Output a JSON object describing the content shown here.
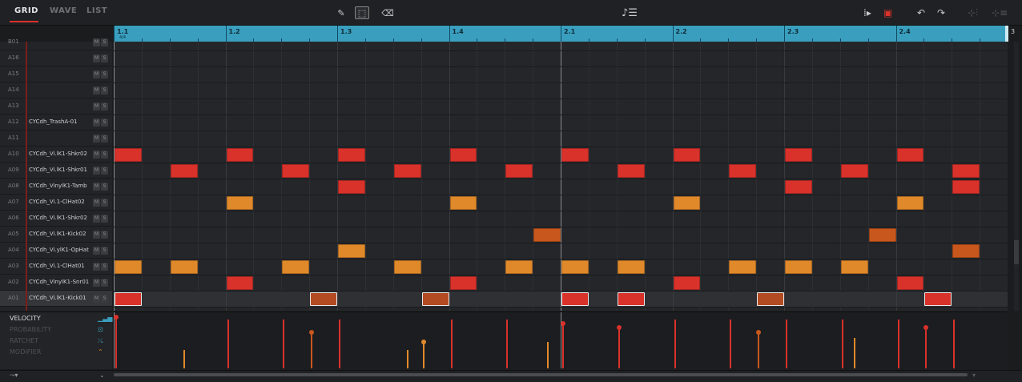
{
  "tabs": [
    "GRID",
    "WAVE",
    "LIST"
  ],
  "active_tab": "GRID",
  "toolbar": {
    "pencil_icon": "pencil-icon",
    "select_icon": "select-box-icon",
    "eraser_icon": "eraser-icon",
    "note_list_icon": "note-list-icon",
    "undo_icon": "undo-icon",
    "redo_icon": "redo-icon"
  },
  "ruler": {
    "labels": [
      "1.1",
      "1.2",
      "1.3",
      "1.4",
      "2.1",
      "2.2",
      "2.3",
      "2.4"
    ],
    "time_signature": "4/4",
    "end_label": "3"
  },
  "tracks": [
    {
      "pad": "B01",
      "name": ""
    },
    {
      "pad": "A16",
      "name": ""
    },
    {
      "pad": "A15",
      "name": ""
    },
    {
      "pad": "A14",
      "name": ""
    },
    {
      "pad": "A13",
      "name": ""
    },
    {
      "pad": "A12",
      "name": "CYCdh_TrashA-01"
    },
    {
      "pad": "A11",
      "name": ""
    },
    {
      "pad": "A10",
      "name": "CYCdh_Vi.lK1-Shkr02"
    },
    {
      "pad": "A09",
      "name": "CYCdh_Vi.lK1-Shkr01"
    },
    {
      "pad": "A08",
      "name": "CYCdh_VinylK1-Tamb"
    },
    {
      "pad": "A07",
      "name": "CYCdh_Vi.1-ClHat02"
    },
    {
      "pad": "A06",
      "name": "CYCdh_Vi.lK1-Shkr02"
    },
    {
      "pad": "A05",
      "name": "CYCdh_Vi.lK1-Kick02"
    },
    {
      "pad": "A04",
      "name": "CYCdh_Vi.ylK1-OpHat"
    },
    {
      "pad": "A03",
      "name": "CYCdh_Vi.1-ClHat01"
    },
    {
      "pad": "A02",
      "name": "CYCdh_VinylK1-Snr01"
    },
    {
      "pad": "A01",
      "name": "CYCdh_Vi.lK1-Kick01"
    }
  ],
  "mute_label": "M",
  "solo_label": "S",
  "selected_track": "A01",
  "colors": {
    "red": "#d8322b",
    "orange": "#e0892a",
    "orange_dark": "#c8571d",
    "kick_selected": "#b24b22",
    "ruler": "#3a9fbf"
  },
  "notes": [
    {
      "track": "A10",
      "step": 0,
      "color": "red"
    },
    {
      "track": "A10",
      "step": 4,
      "color": "red"
    },
    {
      "track": "A10",
      "step": 8,
      "color": "red"
    },
    {
      "track": "A10",
      "step": 12,
      "color": "red"
    },
    {
      "track": "A10",
      "step": 16,
      "color": "red"
    },
    {
      "track": "A10",
      "step": 20,
      "color": "red"
    },
    {
      "track": "A10",
      "step": 24,
      "color": "red"
    },
    {
      "track": "A10",
      "step": 28,
      "color": "red"
    },
    {
      "track": "A09",
      "step": 2,
      "color": "red"
    },
    {
      "track": "A09",
      "step": 6,
      "color": "red"
    },
    {
      "track": "A09",
      "step": 10,
      "color": "red"
    },
    {
      "track": "A09",
      "step": 14,
      "color": "red"
    },
    {
      "track": "A09",
      "step": 18,
      "color": "red"
    },
    {
      "track": "A09",
      "step": 22,
      "color": "red"
    },
    {
      "track": "A09",
      "step": 26,
      "color": "red"
    },
    {
      "track": "A09",
      "step": 30,
      "color": "red"
    },
    {
      "track": "A08",
      "step": 8,
      "color": "red"
    },
    {
      "track": "A08",
      "step": 24,
      "color": "red"
    },
    {
      "track": "A08",
      "step": 30,
      "color": "red"
    },
    {
      "track": "A07",
      "step": 4,
      "color": "orange"
    },
    {
      "track": "A07",
      "step": 12,
      "color": "orange"
    },
    {
      "track": "A07",
      "step": 20,
      "color": "orange"
    },
    {
      "track": "A07",
      "step": 28,
      "color": "orange"
    },
    {
      "track": "A05",
      "step": 15,
      "color": "orange_dark"
    },
    {
      "track": "A05",
      "step": 27,
      "color": "orange_dark"
    },
    {
      "track": "A04",
      "step": 8,
      "color": "orange"
    },
    {
      "track": "A04",
      "step": 30,
      "color": "orange_dark"
    },
    {
      "track": "A03",
      "step": 0,
      "color": "orange"
    },
    {
      "track": "A03",
      "step": 2,
      "color": "orange"
    },
    {
      "track": "A03",
      "step": 6,
      "color": "orange"
    },
    {
      "track": "A03",
      "step": 10,
      "color": "orange"
    },
    {
      "track": "A03",
      "step": 14,
      "color": "orange"
    },
    {
      "track": "A03",
      "step": 16,
      "color": "orange"
    },
    {
      "track": "A03",
      "step": 18,
      "color": "orange"
    },
    {
      "track": "A03",
      "step": 22,
      "color": "orange"
    },
    {
      "track": "A03",
      "step": 24,
      "color": "orange"
    },
    {
      "track": "A03",
      "step": 26,
      "color": "orange"
    },
    {
      "track": "A02",
      "step": 4,
      "color": "red"
    },
    {
      "track": "A02",
      "step": 12,
      "color": "red"
    },
    {
      "track": "A02",
      "step": 20,
      "color": "red"
    },
    {
      "track": "A02",
      "step": 28,
      "color": "red"
    },
    {
      "track": "A01",
      "step": 0,
      "color": "red",
      "selected": true
    },
    {
      "track": "A01",
      "step": 7,
      "color": "kick_selected",
      "selected": true
    },
    {
      "track": "A01",
      "step": 11,
      "color": "kick_selected",
      "selected": true
    },
    {
      "track": "A01",
      "step": 16,
      "color": "red",
      "selected": true
    },
    {
      "track": "A01",
      "step": 18,
      "color": "red",
      "selected": true
    },
    {
      "track": "A01",
      "step": 23,
      "color": "kick_selected",
      "selected": true
    },
    {
      "track": "A01",
      "step": 29,
      "color": "red",
      "selected": true
    }
  ],
  "lanes": [
    {
      "label": "VELOCITY",
      "icon": "velocity-bars-icon"
    },
    {
      "label": "PROBABILITY",
      "icon": "probability-icon"
    },
    {
      "label": "RATCHET",
      "icon": "ratchet-icon"
    },
    {
      "label": "MODIFIER",
      "icon": "modifier-icon"
    }
  ],
  "active_lane": "VELOCITY",
  "velocity_markers": [
    {
      "step": 0,
      "level": 1.0,
      "color": "red",
      "dot": true
    },
    {
      "step": 4,
      "level": 0.95,
      "color": "red"
    },
    {
      "step": 6,
      "level": 0.95,
      "color": "red"
    },
    {
      "step": 7,
      "level": 0.7,
      "color": "orange_dark",
      "dot": true
    },
    {
      "step": 8,
      "level": 0.95,
      "color": "red"
    },
    {
      "step": 11,
      "level": 0.52,
      "color": "orange",
      "dot": true
    },
    {
      "step": 12,
      "level": 0.95,
      "color": "red"
    },
    {
      "step": 14,
      "level": 0.95,
      "color": "red"
    },
    {
      "step": 16,
      "level": 0.88,
      "color": "red",
      "dot": true
    },
    {
      "step": 18,
      "level": 0.8,
      "color": "red",
      "dot": true
    },
    {
      "step": 20,
      "level": 0.95,
      "color": "red"
    },
    {
      "step": 22,
      "level": 0.95,
      "color": "red"
    },
    {
      "step": 23,
      "level": 0.7,
      "color": "orange_dark",
      "dot": true
    },
    {
      "step": 24,
      "level": 0.95,
      "color": "red"
    },
    {
      "step": 26,
      "level": 0.95,
      "color": "red"
    },
    {
      "step": 28,
      "level": 0.95,
      "color": "red"
    },
    {
      "step": 29,
      "level": 0.8,
      "color": "red",
      "dot": true
    },
    {
      "step": 30,
      "level": 0.95,
      "color": "red"
    }
  ],
  "secondary_velocity": [
    {
      "step": 2,
      "level": 0.36,
      "color": "orange"
    },
    {
      "step": 10,
      "level": 0.36,
      "color": "orange"
    },
    {
      "step": 15,
      "level": 0.52,
      "color": "orange"
    },
    {
      "step": 26,
      "level": 0.6,
      "color": "orange"
    }
  ],
  "bottom": {
    "track_icon": "track-select-icon",
    "dropdown_icon": "chevron-down-icon"
  }
}
